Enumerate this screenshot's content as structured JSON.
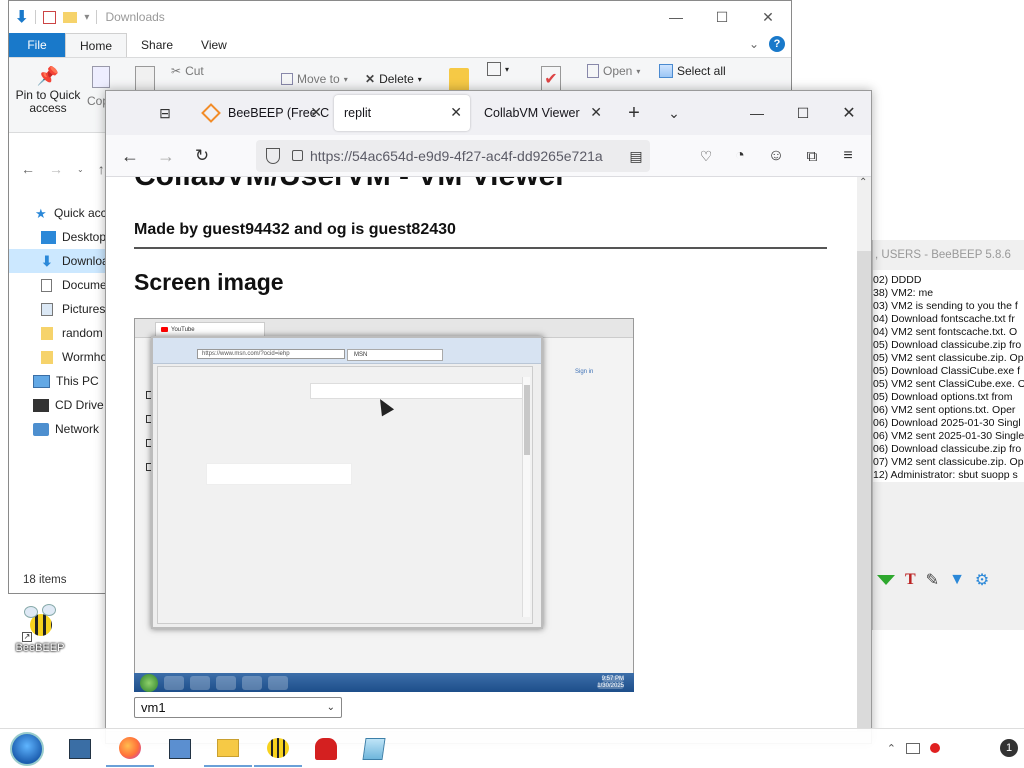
{
  "explorer": {
    "title": "Downloads",
    "tabs": [
      "File",
      "Home",
      "Share",
      "View"
    ],
    "ribbon": {
      "pin": "Pin to Quick access",
      "copy": "Copy",
      "cut": "Cut",
      "move_to": "Move to",
      "delete": "Delete",
      "open": "Open",
      "select_all": "Select all"
    },
    "sidebar": [
      "Quick access",
      "Desktop",
      "Downloads",
      "Documents",
      "Pictures",
      "random",
      "Wormhole",
      "This PC",
      "CD Drive (",
      "Network"
    ],
    "item_count": "18 items"
  },
  "beebeep": {
    "title": ", USERS - BeeBEEP 5.8.6",
    "log": [
      "02)      DDDD",
      "38) VM2: me",
      "03) VM2 is sending to you the f",
      "04) Download fontscache.txt fr",
      "04) VM2 sent fontscache.txt. O",
      "05) Download classicube.zip fro",
      "05) VM2 sent classicube.zip. Op",
      "05) Download ClassiCube.exe f",
      "05) VM2 sent ClassiCube.exe. O",
      "05) Download options.txt from",
      "06) VM2 sent options.txt. Oper",
      "06) Download 2025-01-30 Singl",
      "06) VM2 sent 2025-01-30 Single",
      "06) Download classicube.zip fro",
      "07) VM2 sent classicube.zip. Op",
      "12) Administrator: sbut suopp s"
    ]
  },
  "firefox": {
    "tabs": [
      {
        "label": "BeeBEEP (Free C"
      },
      {
        "label": "replit"
      },
      {
        "label": "CollabVM Viewer"
      }
    ],
    "url": "https://54ac654d-e9d9-4f27-ac4f-dd9265e721a"
  },
  "page": {
    "title": "CollabVM/UserVM - VM Viewer",
    "author": "Made by guest94432 and og is guest82430",
    "section_heading": "Screen image",
    "vm_select_value": "vm1"
  },
  "vm_screen": {
    "tab_youtube": "YouTube",
    "address": "https://www.msn.com/?ocid=iehp",
    "tab_msn": "MSN",
    "sign_in": "Sign in",
    "time": "9:57 PM",
    "date": "1/30/2025"
  },
  "desktop": {
    "bee_label": "BeeBEEP"
  }
}
